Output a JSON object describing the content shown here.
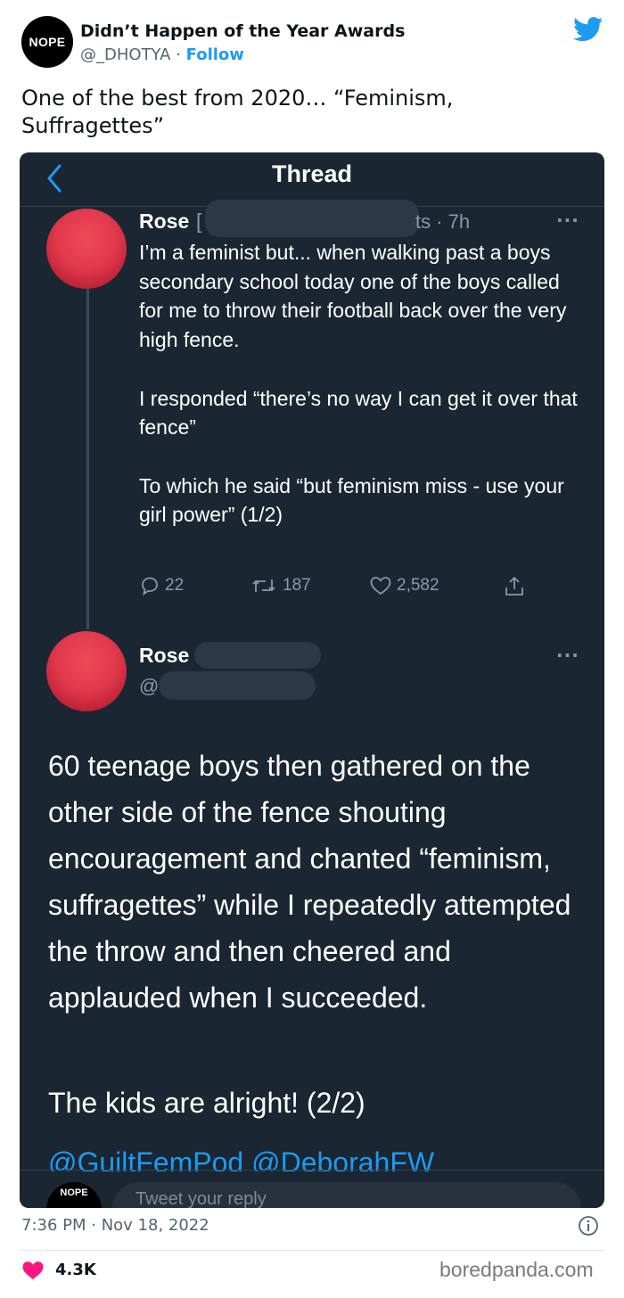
{
  "author": {
    "avatar_text": "NOPE",
    "name": "Didn’t Happen of the Year Awards",
    "handle": "@_DHOTYA",
    "separator": " · ",
    "follow_label": "Follow"
  },
  "tweet": {
    "text": "One of the best from 2020… “Feminism, Suffragettes”",
    "timestamp": "7:36 PM · Nov 18, 2022",
    "likes": "4.3K"
  },
  "screenshot": {
    "header_title": "Thread",
    "first_tweet": {
      "name": "Rose",
      "name_partial": "[",
      "time_fragment": "ts · 7h",
      "more": "···",
      "paragraphs": [
        "I’m a feminist but... when walking past a boys secondary school today one of the boys called for me to throw their football back over the very high fence.",
        "I responded “there’s no way I can get it over that fence”",
        "To which he said “but feminism miss - use your girl power” (1/2)"
      ],
      "replies": "22",
      "retweets": "187",
      "likes": "2,582"
    },
    "second_tweet": {
      "name": "Rose",
      "handle_prefix": "@",
      "more": "···",
      "body": "60 teenage boys then gathered on the other side of the fence shouting encouragement and chanted “feminism, suffragettes” while I repeatedly attempted the throw and then cheered and applauded when I succeeded.",
      "ending": "The kids are alright! (2/2)",
      "mentions": "@GuiltFemPod @DeborahFW"
    },
    "reply_bar": {
      "avatar_text": "NOPE",
      "placeholder": "Tweet your reply"
    }
  },
  "watermark": "boredpanda.com",
  "colors": {
    "accent": "#1d9bf0",
    "like": "#f91880",
    "dark_bg": "#1b2633",
    "muted": "#536471"
  }
}
